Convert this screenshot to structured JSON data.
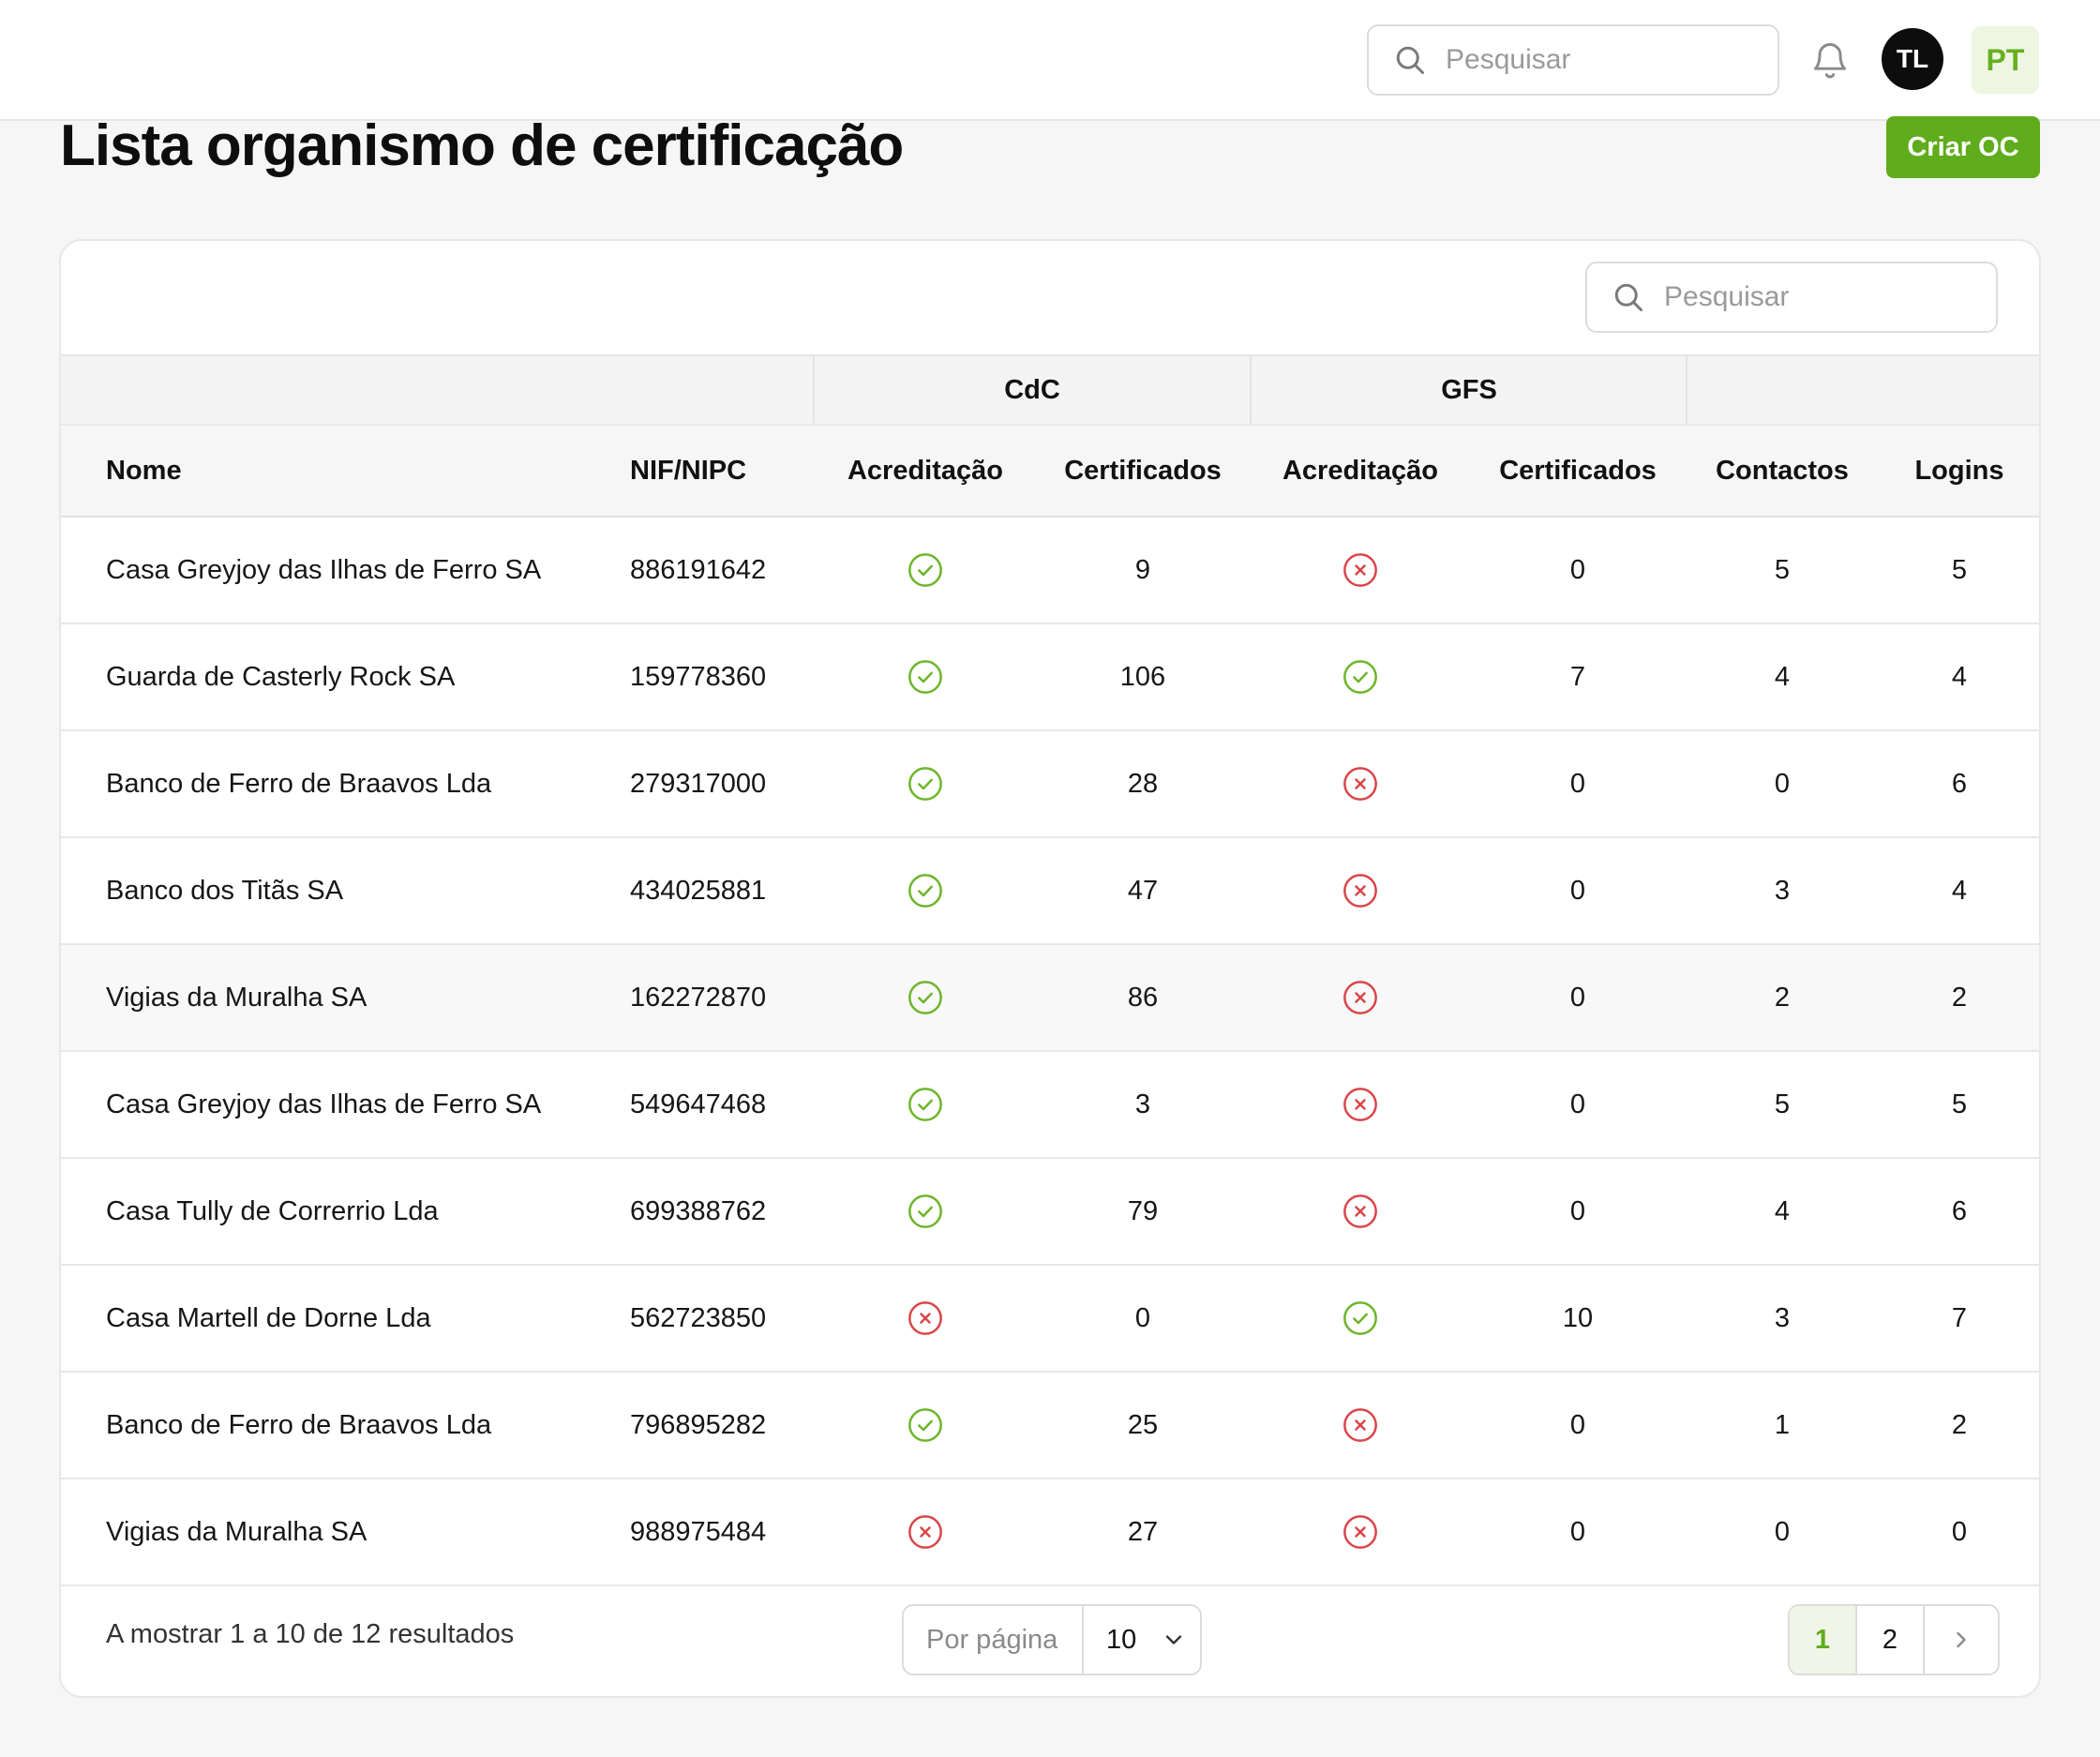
{
  "topbar": {
    "search_placeholder": "Pesquisar",
    "avatar_initials": "TL",
    "language": "PT"
  },
  "page": {
    "title": "Lista organismo de certificação",
    "create_button": "Criar OC"
  },
  "table": {
    "search_placeholder": "Pesquisar",
    "groups": {
      "cdc": "CdC",
      "gfs": "GFS"
    },
    "columns": {
      "nome": "Nome",
      "nif": "NIF/NIPC",
      "cdc_acreditacao": "Acreditação",
      "cdc_certificados": "Certificados",
      "gfs_acreditacao": "Acreditação",
      "gfs_certificados": "Certificados",
      "contactos": "Contactos",
      "logins": "Logins"
    },
    "rows": [
      {
        "nome": "Casa Greyjoy das Ilhas de Ferro SA",
        "nif": "886191642",
        "cdc_acreditacao": true,
        "cdc_certificados": "9",
        "gfs_acreditacao": false,
        "gfs_certificados": "0",
        "contactos": "5",
        "logins": "5"
      },
      {
        "nome": "Guarda de Casterly Rock SA",
        "nif": "159778360",
        "cdc_acreditacao": true,
        "cdc_certificados": "106",
        "gfs_acreditacao": true,
        "gfs_certificados": "7",
        "contactos": "4",
        "logins": "4"
      },
      {
        "nome": "Banco de Ferro de Braavos Lda",
        "nif": "279317000",
        "cdc_acreditacao": true,
        "cdc_certificados": "28",
        "gfs_acreditacao": false,
        "gfs_certificados": "0",
        "contactos": "0",
        "logins": "6"
      },
      {
        "nome": "Banco dos Titãs SA",
        "nif": "434025881",
        "cdc_acreditacao": true,
        "cdc_certificados": "47",
        "gfs_acreditacao": false,
        "gfs_certificados": "0",
        "contactos": "3",
        "logins": "4"
      },
      {
        "nome": "Vigias da Muralha SA",
        "nif": "162272870",
        "cdc_acreditacao": true,
        "cdc_certificados": "86",
        "gfs_acreditacao": false,
        "gfs_certificados": "0",
        "contactos": "2",
        "logins": "2"
      },
      {
        "nome": "Casa Greyjoy das Ilhas de Ferro SA",
        "nif": "549647468",
        "cdc_acreditacao": true,
        "cdc_certificados": "3",
        "gfs_acreditacao": false,
        "gfs_certificados": "0",
        "contactos": "5",
        "logins": "5"
      },
      {
        "nome": "Casa Tully de Correrrio Lda",
        "nif": "699388762",
        "cdc_acreditacao": true,
        "cdc_certificados": "79",
        "gfs_acreditacao": false,
        "gfs_certificados": "0",
        "contactos": "4",
        "logins": "6"
      },
      {
        "nome": "Casa Martell de Dorne Lda",
        "nif": "562723850",
        "cdc_acreditacao": false,
        "cdc_certificados": "0",
        "gfs_acreditacao": true,
        "gfs_certificados": "10",
        "contactos": "3",
        "logins": "7"
      },
      {
        "nome": "Banco de Ferro de Braavos Lda",
        "nif": "796895282",
        "cdc_acreditacao": true,
        "cdc_certificados": "25",
        "gfs_acreditacao": false,
        "gfs_certificados": "0",
        "contactos": "1",
        "logins": "2"
      },
      {
        "nome": "Vigias da Muralha SA",
        "nif": "988975484",
        "cdc_acreditacao": false,
        "cdc_certificados": "27",
        "gfs_acreditacao": false,
        "gfs_certificados": "0",
        "contactos": "0",
        "logins": "0"
      }
    ],
    "highlighted_row": 4
  },
  "footer": {
    "results_text": "A mostrar 1 a 10 de 12 resultados",
    "per_page_label": "Por página",
    "per_page_value": "10",
    "pages": [
      "1",
      "2"
    ],
    "current_page": "1"
  },
  "colors": {
    "accent": "#5fac1c",
    "success": "#6db52a",
    "error": "#d9464a"
  },
  "icons": {
    "accredited": "check-circle-icon",
    "not_accredited": "x-circle-icon"
  }
}
